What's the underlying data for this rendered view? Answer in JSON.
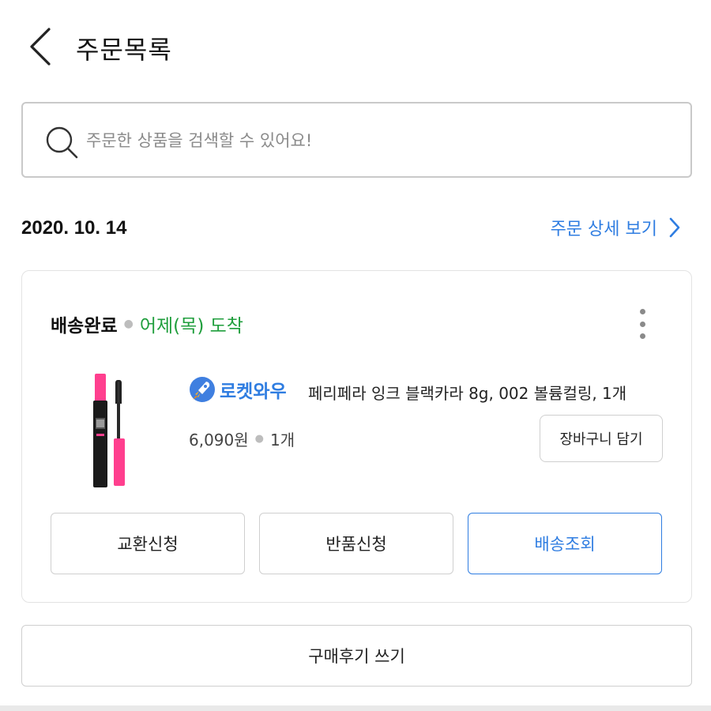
{
  "header": {
    "title": "주문목록"
  },
  "search": {
    "placeholder": "주문한 상품을 검색할 수 있어요!",
    "value": ""
  },
  "order": {
    "date": "2020. 10. 14",
    "detail_link_label": "주문 상세 보기",
    "status": "배송완료",
    "arrival": "어제(목) 도착",
    "badge_label": "로켓와우",
    "product_name": "페리페라 잉크 블랙카라 8g, 002 볼륨컬링, 1개",
    "price": "6,090원",
    "quantity": "1개",
    "cart_button_label": "장바구니 담기",
    "actions": [
      "교환신청",
      "반품신청",
      "배송조회"
    ]
  },
  "review_button_label": "구매후기 쓰기",
  "colors": {
    "accent": "#2f7de1",
    "delivered_green": "#1f9e3c",
    "product_pink": "#ff3f8e"
  },
  "icons": {
    "back": "chevron-left-icon",
    "search": "search-icon",
    "detail": "chevron-right-icon",
    "more": "more-vertical-icon",
    "badge": "rocket-icon"
  }
}
